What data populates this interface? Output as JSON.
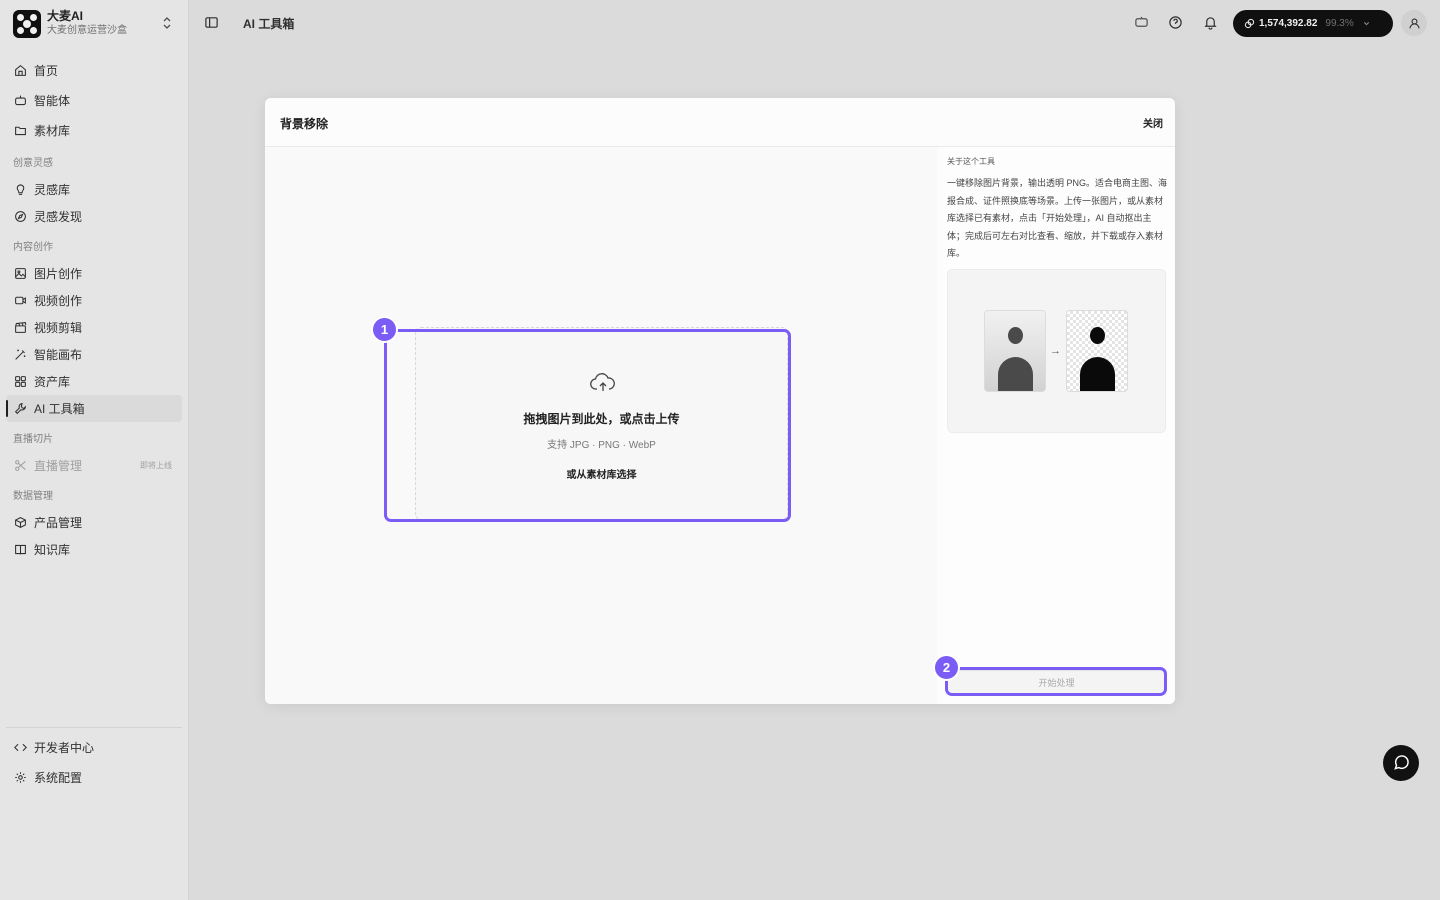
{
  "brand": {
    "name": "大麦AI",
    "subtitle": "大麦创意运营沙盒"
  },
  "nav": {
    "top": [
      {
        "label": "首页",
        "icon": "home-icon"
      },
      {
        "label": "智能体",
        "icon": "bot-icon"
      },
      {
        "label": "素材库",
        "icon": "folder-icon"
      }
    ],
    "groups": [
      {
        "label": "创意灵感",
        "items": [
          {
            "label": "灵感库",
            "icon": "lightbulb-icon"
          },
          {
            "label": "灵感发现",
            "icon": "compass-icon"
          }
        ]
      },
      {
        "label": "内容创作",
        "items": [
          {
            "label": "图片创作",
            "icon": "image-icon"
          },
          {
            "label": "视频创作",
            "icon": "video-icon"
          },
          {
            "label": "视频剪辑",
            "icon": "clapperboard-icon"
          },
          {
            "label": "智能画布",
            "icon": "magic-wand-icon"
          },
          {
            "label": "资产库",
            "icon": "grid-icon"
          },
          {
            "label": "AI 工具箱",
            "icon": "wrench-icon",
            "active": true
          }
        ]
      },
      {
        "label": "直播切片",
        "items": [
          {
            "label": "直播管理",
            "icon": "scissors-icon",
            "disabled": true,
            "tag": "即将上线"
          }
        ]
      },
      {
        "label": "数据管理",
        "items": [
          {
            "label": "产品管理",
            "icon": "package-icon"
          },
          {
            "label": "知识库",
            "icon": "book-icon"
          }
        ]
      }
    ],
    "bottom": [
      {
        "label": "开发者中心",
        "icon": "code-icon"
      },
      {
        "label": "系统配置",
        "icon": "settings-icon"
      }
    ]
  },
  "topbar": {
    "title": "AI 工具箱",
    "credits": "1,574,392.82",
    "credits_pct": "99.3%"
  },
  "modal": {
    "title": "背景移除",
    "close_label": "关闭",
    "upload": {
      "title": "拖拽图片到此处，或点击上传",
      "hint": "支持 JPG · PNG · WebP",
      "library_link": "或从素材库选择"
    },
    "about": {
      "label": "关于这个工具",
      "description": "一键移除图片背景，输出透明 PNG。适合电商主图、海报合成、证件照换底等场景。上传一张图片，或从素材库选择已有素材，点击「开始处理」，AI 自动抠出主体；完成后可左右对比查看、缩放，并下载或存入素材库。"
    },
    "preview_arrow": "→",
    "start_label": "开始处理"
  },
  "annotations": {
    "badge_1": "1",
    "badge_2": "2",
    "highlight_color": "#7b5cf5"
  }
}
